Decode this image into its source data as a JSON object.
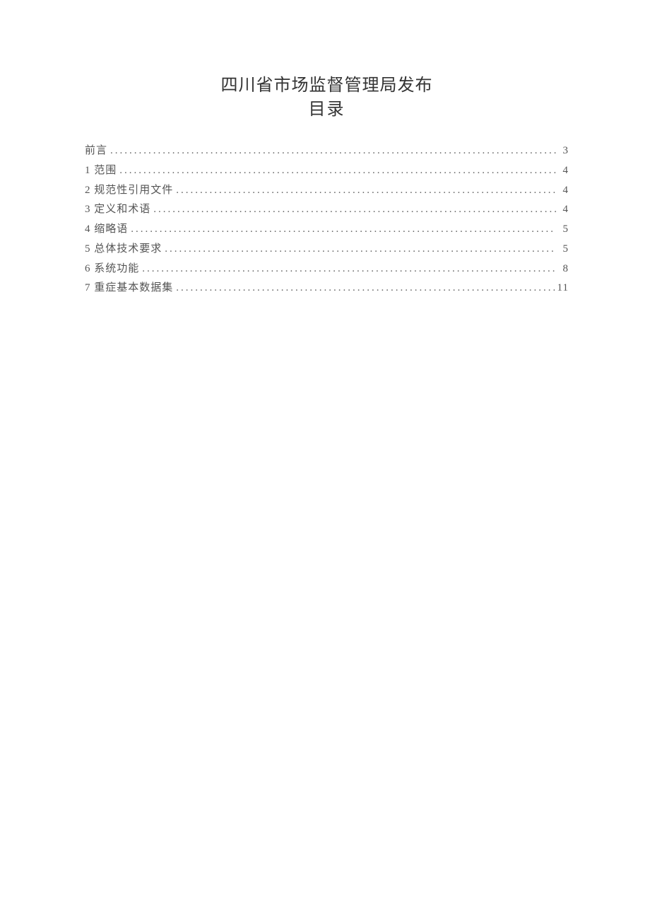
{
  "header": {
    "publisher": "四川省市场监督管理局发布",
    "toc_title": "目录"
  },
  "toc": {
    "entries": [
      {
        "label": "前言",
        "page": "3"
      },
      {
        "label": "1 范围",
        "page": "4"
      },
      {
        "label": "2 规范性引用文件",
        "page": "4"
      },
      {
        "label": "3 定义和术语",
        "page": "4"
      },
      {
        "label": "4 缩略语",
        "page": "5"
      },
      {
        "label": "5 总体技术要求",
        "page": "5"
      },
      {
        "label": "6 系统功能",
        "page": "8"
      },
      {
        "label": "7 重症基本数据集",
        "page": "11"
      }
    ]
  }
}
